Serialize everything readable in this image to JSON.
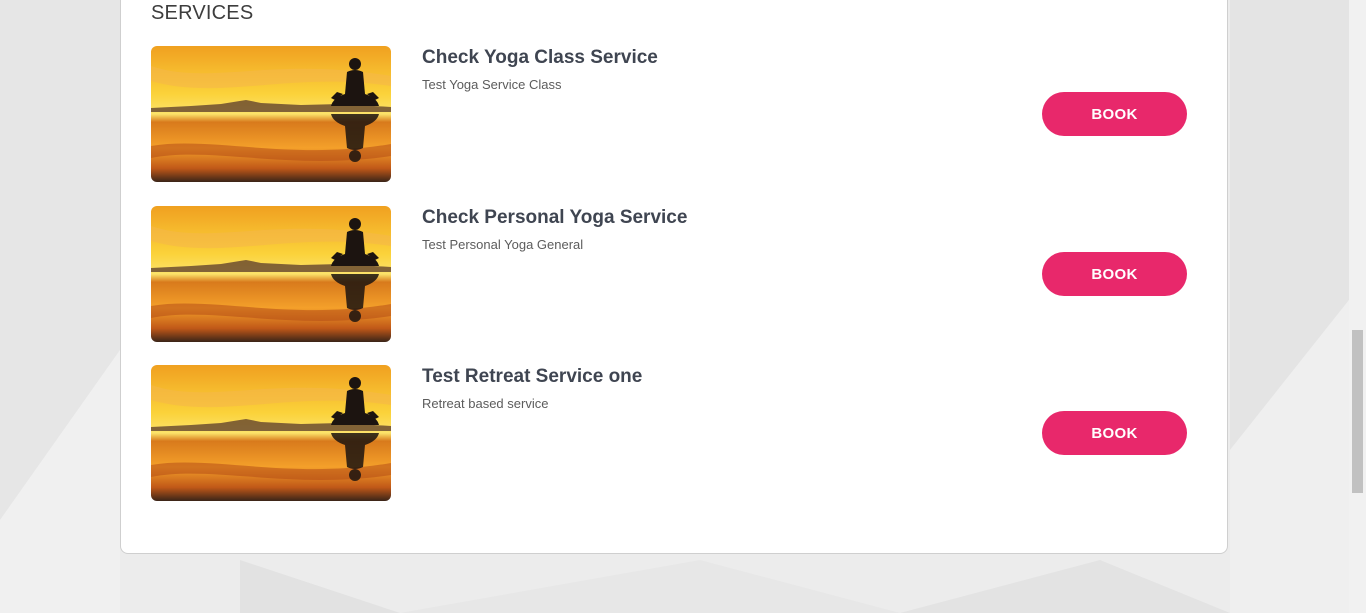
{
  "section": {
    "title": "SERVICES"
  },
  "services": [
    {
      "title": "Check Yoga Class Service",
      "description": "Test Yoga Service Class",
      "book_label": "BOOK"
    },
    {
      "title": "Check Personal Yoga Service",
      "description": "Test Personal Yoga General",
      "book_label": "BOOK"
    },
    {
      "title": "Test Retreat Service one",
      "description": "Retreat based service",
      "book_label": "BOOK"
    }
  ],
  "colors": {
    "accent": "#e8286b",
    "title_text": "#3f4551",
    "page_bg": "#ececec"
  },
  "icons": {
    "service_image": "yoga-sunset-image"
  }
}
